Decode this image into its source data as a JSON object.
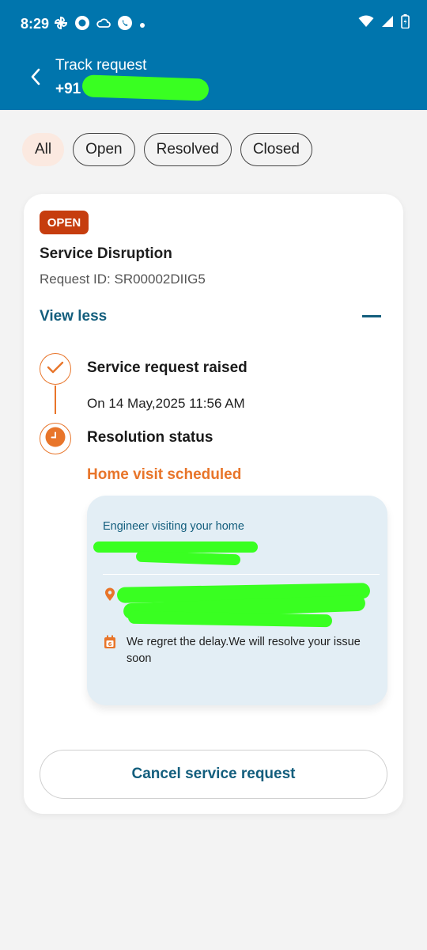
{
  "statusbar": {
    "time": "8:29"
  },
  "header": {
    "title": "Track request",
    "phone_prefix": "+91"
  },
  "filters": [
    {
      "label": "All",
      "active": true
    },
    {
      "label": "Open",
      "active": false
    },
    {
      "label": "Resolved",
      "active": false
    },
    {
      "label": "Closed",
      "active": false
    }
  ],
  "request": {
    "badge": "OPEN",
    "title": "Service Disruption",
    "request_id": "Request ID: SR00002DIIG5",
    "toggle_label": "View less",
    "timeline": [
      {
        "title": "Service request raised",
        "detail": "On 14 May,2025 11:56 AM"
      },
      {
        "title": "Resolution status",
        "detail": "Home visit scheduled"
      }
    ],
    "engineer": {
      "label": "Engineer visiting your home",
      "delay_message": "We regret the delay.We will resolve your issue soon"
    },
    "cancel_label": "Cancel service request"
  },
  "colors": {
    "brand": "#0075ad",
    "accent": "#e8752a",
    "badge": "#c63d0e",
    "link": "#135e7d",
    "redaction": "#39ff21"
  }
}
